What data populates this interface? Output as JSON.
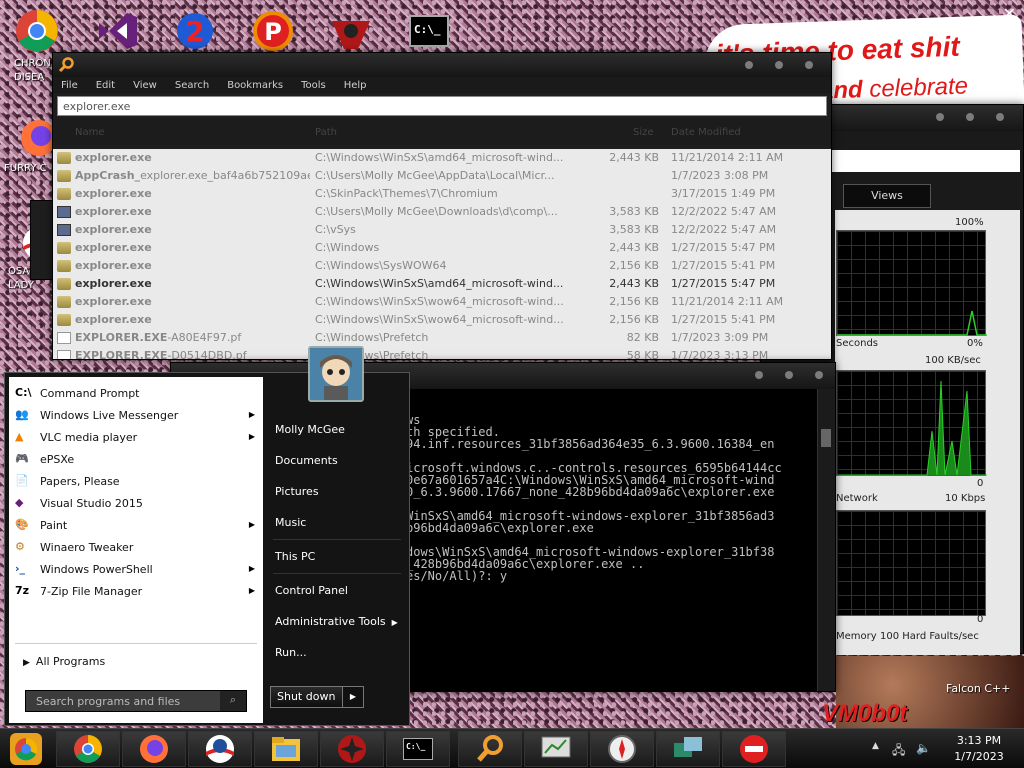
{
  "desktop": {
    "banner_line1": "it's time to eat shit",
    "banner_line2_bold": "and",
    "banner_line2_rest": " celebrate",
    "icon_chrome_label": "CHRON",
    "icon_chrome_label2": "DISEA",
    "icon_firefox_label": "FURRY C",
    "icon_osa_label": "OSA",
    "icon_osa_label2": "LADY",
    "falcon_label": "Falcon C++",
    "vmbot_label": "VM0b0t"
  },
  "everything": {
    "menu": [
      "File",
      "Edit",
      "View",
      "Search",
      "Bookmarks",
      "Tools",
      "Help"
    ],
    "search_value": "explorer.exe",
    "columns": [
      "Name",
      "Path",
      "Size",
      "Date Modified"
    ],
    "rows": [
      {
        "name": "explorer.exe",
        "suffix": "",
        "path": "C:\\Windows\\WinSxS\\amd64_microsoft-wind...",
        "size": "2,443 KB",
        "date": "11/21/2014 2:11 AM",
        "icon": "folder"
      },
      {
        "name": "AppCrash_",
        "suffix": "explorer.exe_baf4a6b752109aef...",
        "path": "C:\\Users\\Molly McGee\\AppData\\Local\\Micr...",
        "size": "",
        "date": "1/7/2023 3:08 PM",
        "icon": "folder"
      },
      {
        "name": "explorer.exe",
        "suffix": "",
        "path": "C:\\SkinPack\\Themes\\7\\Chromium",
        "size": "",
        "date": "3/17/2015 1:49 PM",
        "icon": "folder"
      },
      {
        "name": "explorer.exe",
        "suffix": "",
        "path": "C:\\Users\\Molly McGee\\Downloads\\d\\comp\\...",
        "size": "3,583 KB",
        "date": "12/2/2022 5:47 AM",
        "icon": "exe"
      },
      {
        "name": "explorer.exe",
        "suffix": "",
        "path": "C:\\vSys",
        "size": "3,583 KB",
        "date": "12/2/2022 5:47 AM",
        "icon": "exe"
      },
      {
        "name": "explorer.exe",
        "suffix": "",
        "path": "C:\\Windows",
        "size": "2,443 KB",
        "date": "1/27/2015 5:47 PM",
        "icon": "folder"
      },
      {
        "name": "explorer.exe",
        "suffix": "",
        "path": "C:\\Windows\\SysWOW64",
        "size": "2,156 KB",
        "date": "1/27/2015 5:41 PM",
        "icon": "folder"
      },
      {
        "name": "explorer.exe",
        "suffix": "",
        "path": "C:\\Windows\\WinSxS\\amd64_microsoft-wind...",
        "size": "2,443 KB",
        "date": "1/27/2015 5:47 PM",
        "icon": "folder",
        "selected": true
      },
      {
        "name": "explorer.exe",
        "suffix": "",
        "path": "C:\\Windows\\WinSxS\\wow64_microsoft-wind...",
        "size": "2,156 KB",
        "date": "11/21/2014 2:11 AM",
        "icon": "folder"
      },
      {
        "name": "explorer.exe",
        "suffix": "",
        "path": "C:\\Windows\\WinSxS\\wow64_microsoft-wind...",
        "size": "2,156 KB",
        "date": "1/27/2015 5:41 PM",
        "icon": "folder"
      },
      {
        "name": "EXPLORER.EXE",
        "suffix": "-A80E4F97.pf",
        "path": "C:\\Windows\\Prefetch",
        "size": "82 KB",
        "date": "1/7/2023 3:09 PM",
        "icon": "pf"
      },
      {
        "name": "EXPLORER.EXE",
        "suffix": "-D0514DBD.pf",
        "path": "C:\\Windows\\Prefetch",
        "size": "58 KB",
        "date": "1/7/2023 3:13 PM",
        "icon": "pf"
      }
    ]
  },
  "task_manager": {
    "tab_label": "Views",
    "label_100pct": "100%",
    "label_0pct": "0%",
    "label_seconds": "Seconds",
    "label_100kb": "100 KB/sec",
    "label_0a": "0",
    "label_network": "Network",
    "label_10kbps": "10 Kbps",
    "label_0b": "0",
    "label_memory": "Memory",
    "label_hardfaults": "100 Hard Faults/sec"
  },
  "cmd": {
    "lines": [
      "ws",
      "th specified.",
      "94.inf.resources_31bf3856ad364e35_6.3.9600.16384_en",
      "",
      "icrosoft.windows.c..-controls.resources_6595b64144cc",
      "0e67a601657a4C:\\Windows\\WinSxS\\amd64_microsoft-wind",
      "0_6.3.9600.17667_none_428b96bd4da09a6c\\explorer.exe",
      "",
      "WinSxS\\amd64_microsoft-windows-explorer_31bf3856ad3",
      "b96bd4da09a6c\\explorer.exe",
      "",
      "dows\\WinSxS\\amd64_microsoft-windows-explorer_31bf38",
      "_428b96bd4da09a6c\\explorer.exe ..",
      "es/No/All)?: y"
    ]
  },
  "start_menu": {
    "programs": [
      {
        "label": "Command Prompt",
        "icon": "cmd-icon",
        "submenu": false
      },
      {
        "label": "Windows Live Messenger",
        "icon": "messenger-icon",
        "submenu": true
      },
      {
        "label": "VLC media player",
        "icon": "vlc-icon",
        "submenu": true
      },
      {
        "label": "ePSXe",
        "icon": "gamepad-icon",
        "submenu": false
      },
      {
        "label": "Papers, Please",
        "icon": "document-icon",
        "submenu": false
      },
      {
        "label": "Visual Studio 2015",
        "icon": "visual-studio-icon",
        "submenu": false
      },
      {
        "label": "Paint",
        "icon": "paint-icon",
        "submenu": true
      },
      {
        "label": "Winaero Tweaker",
        "icon": "tweaker-icon",
        "submenu": false
      },
      {
        "label": "Windows PowerShell",
        "icon": "powershell-icon",
        "submenu": true
      },
      {
        "label": "7-Zip File Manager",
        "icon": "7zip-icon",
        "submenu": true
      }
    ],
    "all_programs": "All Programs",
    "search_placeholder": "Search programs and files",
    "right": {
      "user": "Molly McGee",
      "documents": "Documents",
      "pictures": "Pictures",
      "music": "Music",
      "this_pc": "This PC",
      "control_panel": "Control Panel",
      "admin_tools": "Administrative Tools",
      "run": "Run..."
    },
    "shutdown": "Shut down"
  },
  "taskbar": {
    "time": "3:13 PM",
    "date": "1/7/2023"
  },
  "colors": {
    "accent_orange": "#f0a030",
    "cmd_text": "#c0c0c0",
    "banner_red": "#e01818"
  }
}
